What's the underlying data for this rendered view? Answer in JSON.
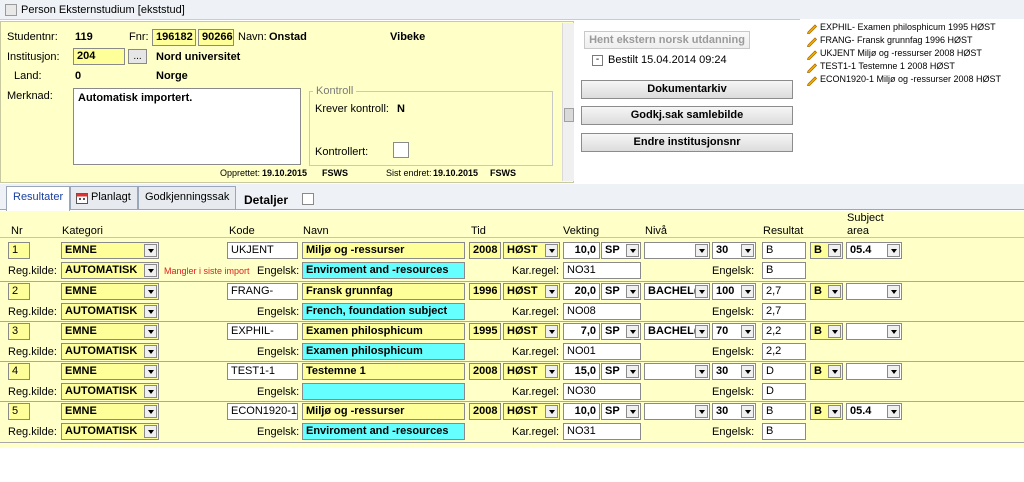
{
  "window": {
    "title": "Person Eksternstudium  [ekststud]"
  },
  "header": {
    "studentnr_label": "Studentnr:",
    "studentnr": "119",
    "fnr_label": "Fnr:",
    "fnr_date": "196182",
    "fnr_number": "90266",
    "navn_label": "Navn:",
    "etternavn": "Onstad",
    "fornavn": "Vibeke",
    "institusjon_label": "Institusjon:",
    "institusjon_kode": "204",
    "institusjon_btn": "...",
    "institusjon_navn": "Nord universitet",
    "land_label": "Land:",
    "land_kode": "0",
    "land_navn": "Norge",
    "merknad_label": "Merknad:",
    "merknad": "Automatisk importert.",
    "kontroll_title": "Kontroll",
    "krever_kontroll_label": "Krever kontroll:",
    "krever_kontroll": "N",
    "kontrollert_label": "Kontrollert:",
    "opprettet_label": "Opprettet:",
    "opprettet_dato": "19.10.2015",
    "opprettet_av": "FSWS",
    "sist_endret_label": "Sist endret:",
    "sist_endret_dato": "19.10.2015",
    "sist_endret_av": "FSWS"
  },
  "actions": {
    "hent_ekstern": "Hent ekstern norsk utdanning",
    "bestilt_toggle": "-",
    "bestilt": "Bestilt 15.04.2014 09:24",
    "dokumentarkiv": "Dokumentarkiv",
    "godkj_samlebilde": "Godkj.sak samlebilde",
    "endre_institusjonsnr": "Endre institusjonsnr"
  },
  "documents": [
    "EXPHIL-  Examen philosphicum 1995 HØST",
    "FRANG-  Fransk grunnfag 1996 HØST",
    "UKJENT Miljø og -ressurser 2008 HØST",
    "TEST1-1 Testemne 1 2008 HØST",
    "ECON1920-1 Miljø og -ressurser 2008 HØST"
  ],
  "tabs": {
    "resultater": "Resultater",
    "planlagt": "Planlagt",
    "godkjenningssak": "Godkjenningssak",
    "detaljer": "Detaljer"
  },
  "columns": {
    "nr": "Nr",
    "kategori": "Kategori",
    "kode": "Kode",
    "navn": "Navn",
    "tid": "Tid",
    "vekting": "Vekting",
    "niva": "Nivå",
    "resultat": "Resultat",
    "subject_area_1": "Subject",
    "subject_area_2": "area"
  },
  "row_labels": {
    "reg_kilde": "Reg.kilde:",
    "engelsk": "Engelsk:",
    "kar_regel": "Kar.regel:",
    "engelsk_res": "Engelsk:"
  },
  "rows": [
    {
      "nr": "1",
      "kategori": "EMNE",
      "reg_kilde": "AUTOMATISK",
      "warning": "Mangler i siste import",
      "kode": "UKJENT",
      "navn": "Miljø og -ressurser",
      "engelsk_navn": "Enviroment and -resources",
      "aar": "2008",
      "termin": "HØST",
      "vekting": "10,0",
      "vekt_enhet": "SP",
      "kar_regel": "NO31",
      "niva": "",
      "niva_kode": "30",
      "resultat": "B",
      "resultat_engelsk": "B",
      "res_combo": "B",
      "subject_area": "05.4"
    },
    {
      "nr": "2",
      "kategori": "EMNE",
      "reg_kilde": "AUTOMATISK",
      "warning": "",
      "kode": "FRANG-",
      "navn": "Fransk grunnfag",
      "engelsk_navn": "French, foundation subject",
      "aar": "1996",
      "termin": "HØST",
      "vekting": "20,0",
      "vekt_enhet": "SP",
      "kar_regel": "NO08",
      "niva": "BACHEL(",
      "niva_kode": "100",
      "resultat": "2,7",
      "resultat_engelsk": "2,7",
      "res_combo": "B",
      "subject_area": ""
    },
    {
      "nr": "3",
      "kategori": "EMNE",
      "reg_kilde": "AUTOMATISK",
      "warning": "",
      "kode": "EXPHIL-",
      "navn": "Examen philosphicum",
      "engelsk_navn": "Examen philosphicum",
      "aar": "1995",
      "termin": "HØST",
      "vekting": "7,0",
      "vekt_enhet": "SP",
      "kar_regel": "NO01",
      "niva": "BACHEL(",
      "niva_kode": "70",
      "resultat": "2,2",
      "resultat_engelsk": "2,2",
      "res_combo": "B",
      "subject_area": ""
    },
    {
      "nr": "4",
      "kategori": "EMNE",
      "reg_kilde": "AUTOMATISK",
      "warning": "",
      "kode": "TEST1-1",
      "navn": "Testemne 1",
      "engelsk_navn": "",
      "aar": "2008",
      "termin": "HØST",
      "vekting": "15,0",
      "vekt_enhet": "SP",
      "kar_regel": "NO30",
      "niva": "",
      "niva_kode": "30",
      "resultat": "D",
      "resultat_engelsk": "D",
      "res_combo": "B",
      "subject_area": ""
    },
    {
      "nr": "5",
      "kategori": "EMNE",
      "reg_kilde": "AUTOMATISK",
      "warning": "",
      "kode": "ECON1920-1",
      "navn": "Miljø og -ressurser",
      "engelsk_navn": "Enviroment and -resources",
      "aar": "2008",
      "termin": "HØST",
      "vekting": "10,0",
      "vekt_enhet": "SP",
      "kar_regel": "NO31",
      "niva": "",
      "niva_kode": "30",
      "resultat": "B",
      "resultat_engelsk": "B",
      "res_combo": "B",
      "subject_area": "05.4"
    }
  ]
}
